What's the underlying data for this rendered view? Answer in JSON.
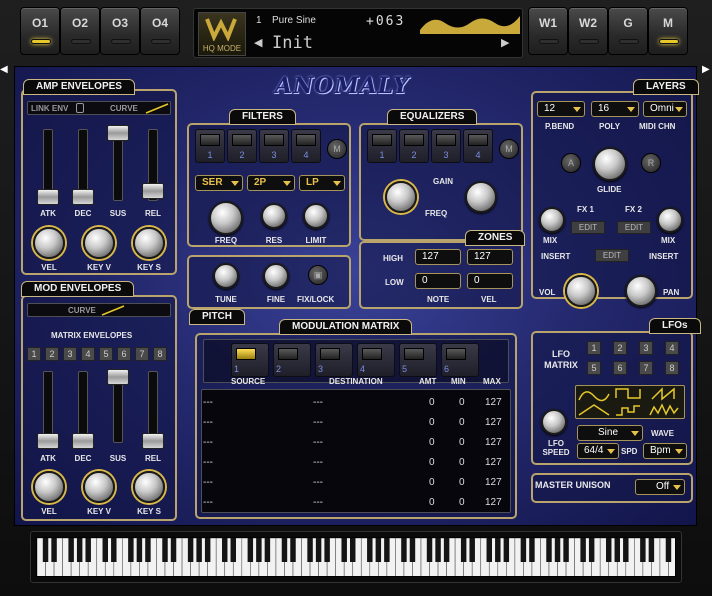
{
  "top_buttons": {
    "o1": "O1",
    "o2": "O2",
    "o3": "O3",
    "o4": "O4",
    "w1": "W1",
    "w2": "W2",
    "g": "G",
    "m": "M"
  },
  "display": {
    "hq_mode": "HQ MODE",
    "patch_number": "1",
    "patch_name": "Pure Sine",
    "preset_name": "Init",
    "value": "+063"
  },
  "logo": "ANOMALY",
  "amp_envelopes": {
    "title": "AMP ENVELOPES",
    "link_env": "LINK ENV",
    "curve": "CURVE",
    "sliders": [
      {
        "label": "ATK",
        "value": 0.15
      },
      {
        "label": "DEC",
        "value": 0.15
      },
      {
        "label": "SUS",
        "value": 1.0
      },
      {
        "label": "REL",
        "value": 0.2
      }
    ],
    "knobs": [
      "VEL",
      "KEY V",
      "KEY S"
    ]
  },
  "mod_envelopes": {
    "title": "MOD ENVELOPES",
    "curve": "CURVE",
    "matrix_label": "MATRIX ENVELOPES",
    "numbers": [
      "1",
      "2",
      "3",
      "4",
      "5",
      "6",
      "7",
      "8"
    ],
    "sliders": [
      {
        "label": "ATK",
        "value": 0.15
      },
      {
        "label": "DEC",
        "value": 0.15
      },
      {
        "label": "SUS",
        "value": 1.0
      },
      {
        "label": "REL",
        "value": 0.15
      }
    ],
    "knobs": [
      "VEL",
      "KEY V",
      "KEY S"
    ]
  },
  "filters": {
    "title": "FILTERS",
    "slots": [
      "1",
      "2",
      "3",
      "4"
    ],
    "m": "M",
    "routing": "SER",
    "slope": "2P",
    "type": "LP",
    "knobs": [
      "FREQ",
      "RES",
      "LIMIT"
    ]
  },
  "equalizers": {
    "title": "EQUALIZERS",
    "slots": [
      "1",
      "2",
      "3",
      "4"
    ],
    "m": "M",
    "gain": "GAIN",
    "freq": "FREQ"
  },
  "zones": {
    "title": "ZONES",
    "high": "HIGH",
    "low": "LOW",
    "high_note": "127",
    "high_vel": "127",
    "low_note": "0",
    "low_vel": "0",
    "note": "NOTE",
    "vel": "VEL"
  },
  "pitch": {
    "title": "PITCH",
    "tune": "TUNE",
    "fine": "FINE",
    "fix_lock": "FIX/LOCK"
  },
  "mod_matrix": {
    "title": "MODULATION MATRIX",
    "slots": [
      "1",
      "2",
      "3",
      "4",
      "5",
      "6"
    ],
    "headers": {
      "source": "SOURCE",
      "destination": "DESTINATION",
      "amt": "AMT",
      "min": "MIN",
      "max": "MAX"
    },
    "rows": [
      {
        "source": "---",
        "destination": "---",
        "amt": "0",
        "min": "0",
        "max": "127"
      },
      {
        "source": "---",
        "destination": "---",
        "amt": "0",
        "min": "0",
        "max": "127"
      },
      {
        "source": "---",
        "destination": "---",
        "amt": "0",
        "min": "0",
        "max": "127"
      },
      {
        "source": "---",
        "destination": "---",
        "amt": "0",
        "min": "0",
        "max": "127"
      },
      {
        "source": "---",
        "destination": "---",
        "amt": "0",
        "min": "0",
        "max": "127"
      },
      {
        "source": "---",
        "destination": "---",
        "amt": "0",
        "min": "0",
        "max": "127"
      }
    ]
  },
  "layers": {
    "title": "LAYERS",
    "pbend_value": "12",
    "poly_value": "16",
    "midi_value": "Omni",
    "pbend": "P.BEND",
    "poly": "POLY",
    "midi_chn": "MIDI CHN",
    "a": "A",
    "r": "R",
    "glide": "GLIDE",
    "fx1": "FX 1",
    "fx2": "FX 2",
    "edit": "EDIT",
    "mix": "MIX",
    "insert": "INSERT",
    "vol": "VOL",
    "pan": "PAN"
  },
  "lfos": {
    "title": "LFOs",
    "lfo_matrix": "LFO MATRIX",
    "numbers": [
      "1",
      "2",
      "3",
      "4",
      "5",
      "6",
      "7",
      "8"
    ],
    "wave_value": "Sine",
    "wave": "WAVE",
    "speed_value": "64/4",
    "spd": "SPD",
    "bpm": "Bpm",
    "lfo_speed": "LFO SPEED"
  },
  "master_unison": {
    "label": "MASTER UNISON",
    "value": "Off"
  },
  "colors": {
    "accent": "#e6c82a",
    "panel": "#252a70",
    "border": "#b8a46c"
  }
}
